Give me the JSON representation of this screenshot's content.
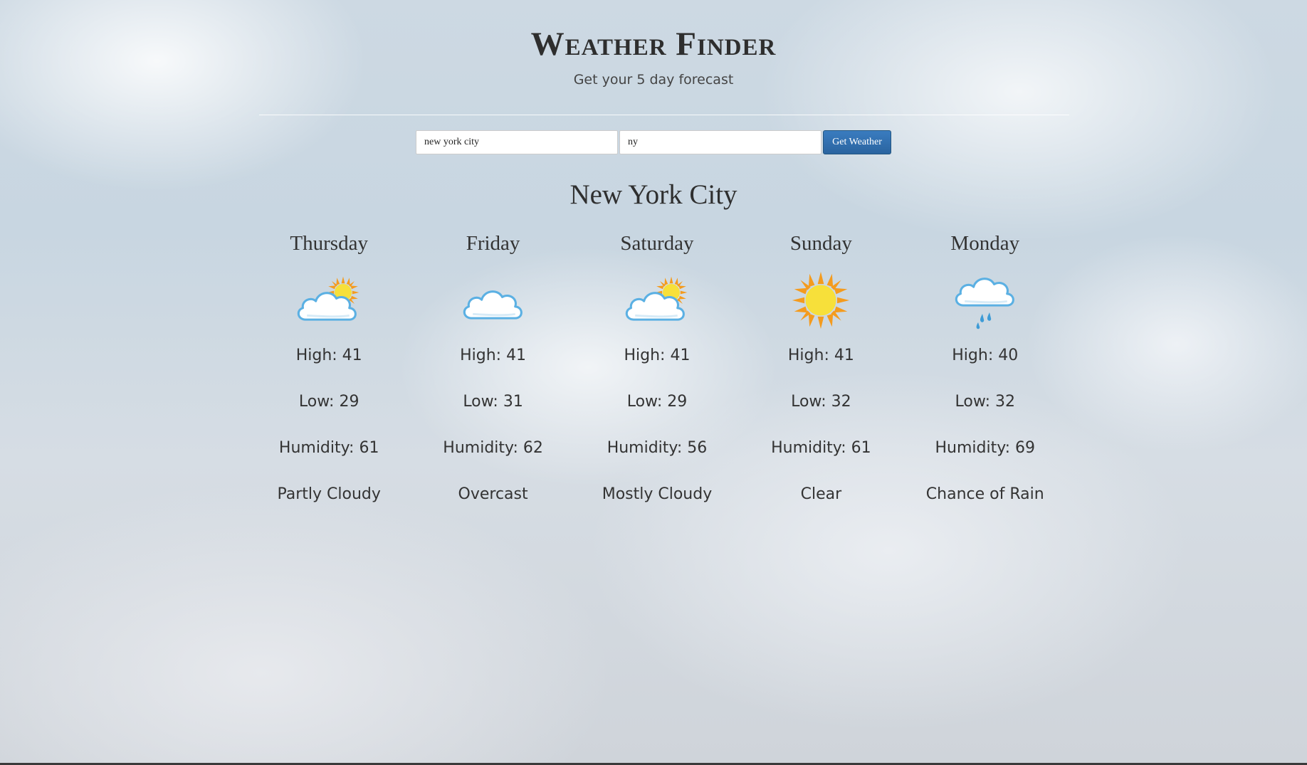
{
  "header": {
    "title": "Weather Finder",
    "subtitle": "Get your 5 day forecast"
  },
  "search": {
    "city_value": "new york city",
    "state_value": "ny",
    "button_label": "Get Weather"
  },
  "city_name": "New York City",
  "forecast": [
    {
      "day": "Thursday",
      "icon": "partly-cloudy-icon",
      "high": "High: 41",
      "low": "Low: 29",
      "humidity": "Humidity: 61",
      "condition": "Partly Cloudy"
    },
    {
      "day": "Friday",
      "icon": "cloud-icon",
      "high": "High: 41",
      "low": "Low: 31",
      "humidity": "Humidity: 62",
      "condition": "Overcast"
    },
    {
      "day": "Saturday",
      "icon": "partly-cloudy-icon",
      "high": "High: 41",
      "low": "Low: 29",
      "humidity": "Humidity: 56",
      "condition": "Mostly Cloudy"
    },
    {
      "day": "Sunday",
      "icon": "sun-icon",
      "high": "High: 41",
      "low": "Low: 32",
      "humidity": "Humidity: 61",
      "condition": "Clear"
    },
    {
      "day": "Monday",
      "icon": "rain-cloud-icon",
      "high": "High: 40",
      "low": "Low: 32",
      "humidity": "Humidity: 69",
      "condition": "Chance of Rain"
    }
  ],
  "colors": {
    "button": "#2a64a0",
    "sun": "#f7e03a",
    "sun_rays": "#f49b1e",
    "cloud_outline": "#5bb0e3"
  }
}
